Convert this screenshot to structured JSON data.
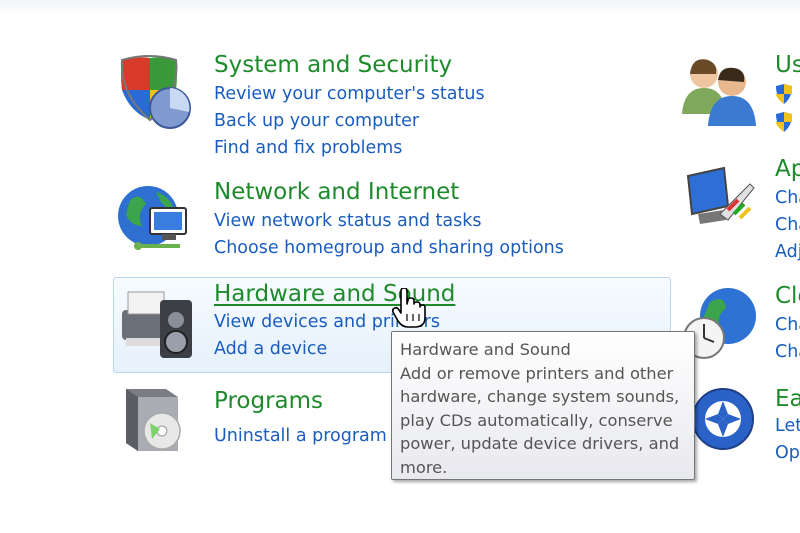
{
  "categories": [
    {
      "id": "system-security",
      "title": "System and Security",
      "links": [
        "Review your computer's status",
        "Back up your computer",
        "Find and fix problems"
      ],
      "icon": "shield-pie-icon"
    },
    {
      "id": "network-internet",
      "title": "Network and Internet",
      "links": [
        "View network status and tasks",
        "Choose homegroup and sharing options"
      ],
      "icon": "globe-network-icon"
    },
    {
      "id": "hardware-sound",
      "title": "Hardware and Sound",
      "links": [
        "View devices and printers",
        "Add a device"
      ],
      "icon": "printer-speaker-icon"
    },
    {
      "id": "programs",
      "title": "Programs",
      "links": [
        "Uninstall a program"
      ],
      "icon": "programs-box-icon"
    }
  ],
  "right_column": [
    {
      "id": "user-accounts",
      "title": "Us",
      "links": [],
      "icon": "users-icon"
    },
    {
      "id": "appearance",
      "title": "Ap",
      "links": [
        "Cha",
        "Cha",
        "Adj"
      ],
      "icon": "monitor-palette-icon"
    },
    {
      "id": "clock",
      "title": "Clo",
      "links": [
        "Cha",
        "Cha"
      ],
      "icon": "clock-globe-icon"
    },
    {
      "id": "ease-of-access",
      "title": "Ea",
      "links": [
        "Let",
        "Op"
      ],
      "icon": "ease-of-access-icon"
    }
  ],
  "tooltip": {
    "title": "Hardware and Sound",
    "lines": [
      "Add or remove printers and other",
      "hardware, change system sounds,",
      "play CDs automatically, conserve",
      "power, update device drivers, and",
      "more."
    ]
  },
  "colors": {
    "title_green": "#1e8a2c",
    "link_blue": "#1a5dbf",
    "hover_border": "#b8d6f0"
  }
}
